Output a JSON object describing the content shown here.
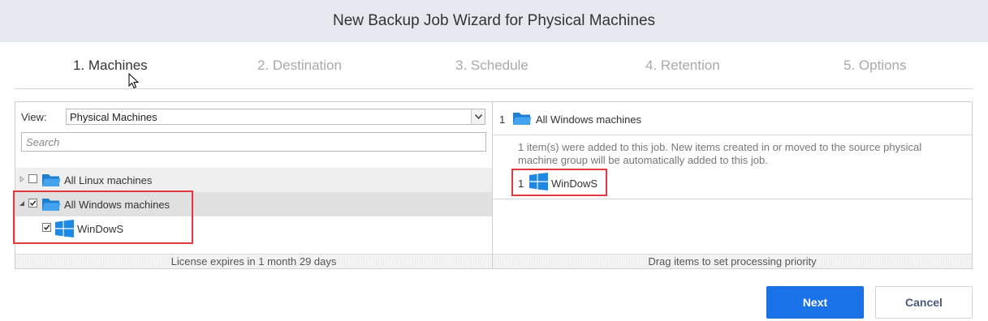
{
  "window": {
    "title": "New Backup Job Wizard for Physical Machines"
  },
  "steps": [
    {
      "label": "1. Machines",
      "active": true
    },
    {
      "label": "2. Destination",
      "active": false
    },
    {
      "label": "3. Schedule",
      "active": false
    },
    {
      "label": "4. Retention",
      "active": false
    },
    {
      "label": "5. Options",
      "active": false
    }
  ],
  "left_panel": {
    "view_label": "View:",
    "view_value": "Physical Machines",
    "search_placeholder": "Search",
    "tree": [
      {
        "label": "All Linux machines",
        "checked": false,
        "expanded": false,
        "icon": "folder-icon"
      },
      {
        "label": "All Windows machines",
        "checked": true,
        "expanded": true,
        "icon": "folder-icon"
      },
      {
        "label": "WinDowS",
        "checked": true,
        "icon": "windows-icon"
      }
    ],
    "footer": "License expires in 1 month 29 days"
  },
  "right_panel": {
    "group_number": "1",
    "group_label": "All Windows machines",
    "note": "1 item(s) were added to this job. New items created in or moved to the source physical machine group will be automatically added to this job.",
    "items": [
      {
        "number": "1",
        "label": "WinDowS",
        "icon": "windows-icon"
      }
    ],
    "footer": "Drag items to set processing priority"
  },
  "buttons": {
    "next": "Next",
    "cancel": "Cancel"
  },
  "colors": {
    "accent": "#1a73e8",
    "highlight_border": "#e03a3e",
    "folder": "#2a8fdc",
    "windows_logo": "#1e88e5"
  }
}
